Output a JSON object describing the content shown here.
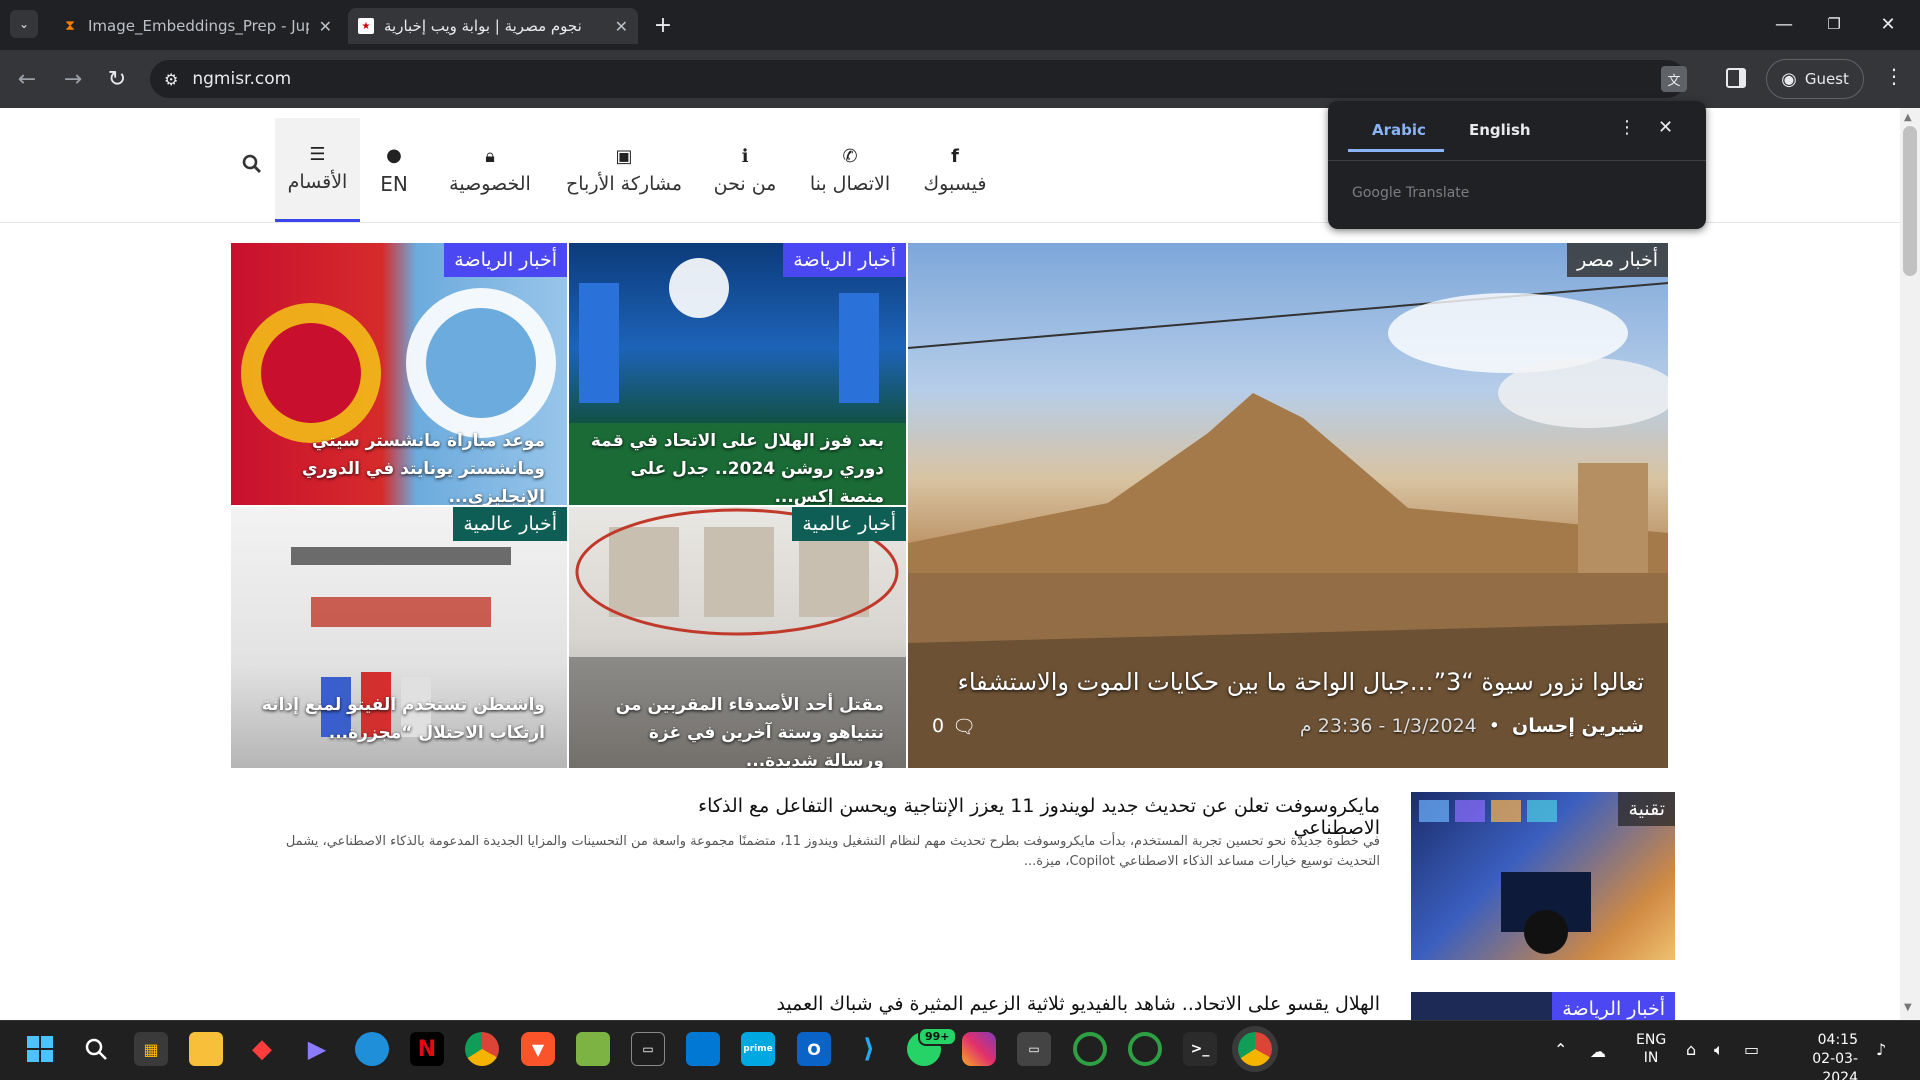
{
  "browser": {
    "tabs": [
      {
        "title": "Image_Embeddings_Prep - Jupy",
        "icon": "hourglass-icon"
      },
      {
        "title": "نجوم مصرية | بوابة ويب إخبارية",
        "icon": "site-favicon"
      }
    ],
    "url": "ngmisr.com",
    "profile": "Guest"
  },
  "site": {
    "nav": [
      {
        "label": "فيسبوك",
        "icon": "facebook-icon"
      },
      {
        "label": "الاتصال بنا",
        "icon": "phone-icon"
      },
      {
        "label": "من نحن",
        "icon": "info-icon"
      },
      {
        "label": "مشاركة الأرباح",
        "icon": "money-icon"
      },
      {
        "label": "الخصوصية",
        "icon": "lock-icon"
      },
      {
        "label": "EN",
        "icon": "globe-icon"
      },
      {
        "label": "الأقسام",
        "icon": "hamburger-icon"
      }
    ]
  },
  "translate": {
    "lang_active": "Arabic",
    "lang_other": "English",
    "brand": "Google Translate"
  },
  "featured": {
    "category": "أخبار مصر",
    "title": "تعالوا نزور سيوة “3”…جبال الواحة ما بين حكايات الموت والاستشفاء",
    "author": "شيرين إحسان",
    "date": "1/3/2024 - 23:36 م",
    "comments": "0"
  },
  "grid": [
    {
      "category": "أخبار الرياضة",
      "title": "بعد فوز الهلال على الاتحاد في قمة دوري روشن 2024.. جدل على منصة إكس..."
    },
    {
      "category": "أخبار الرياضة",
      "title": "موعد مباراة مانشستر سيتي ومانشستر يونايتد في الدوري الإنجليزي..."
    },
    {
      "category": "أخبار عالمية",
      "title": "مقتل أحد الأصدقاء المقربين من نتنياهو وستة آخرين في غزة ورسالة شديدة..."
    },
    {
      "category": "أخبار عالمية",
      "title": "واشنطن تستخدم الفيتو لمنع إدانة ارتكاب الاحتلال “مجزرة..."
    }
  ],
  "list": [
    {
      "category": "تقنية",
      "title": "مايكروسوفت تعلن عن تحديث جديد لويندوز 11 يعزز الإنتاجية ويحسن التفاعل مع الذكاء الاصطناعي",
      "excerpt": "في خطوة جديدة نحو تحسين تجربة المستخدم، بدأت مايكروسوفت بطرح تحديث مهم لنظام التشغيل ويندوز 11، متضمنًا مجموعة واسعة من التحسينات والمزايا الجديدة المدعومة بالذكاء الاصطناعي، يشمل التحديث توسيع خيارات مساعد الذكاء الاصطناعي Copilot، ميزة..."
    },
    {
      "category": "أخبار الرياضة",
      "title": "الهلال يقسو على الاتحاد.. شاهد بالفيديو ثلاثية الزعيم المثيرة في شباك العميد",
      "excerpt": ""
    }
  ],
  "taskbar": {
    "lang_top": "ENG",
    "lang_bottom": "IN",
    "time": "04:15",
    "date": "02-03-2024",
    "whatsapp_badge": "99+"
  }
}
